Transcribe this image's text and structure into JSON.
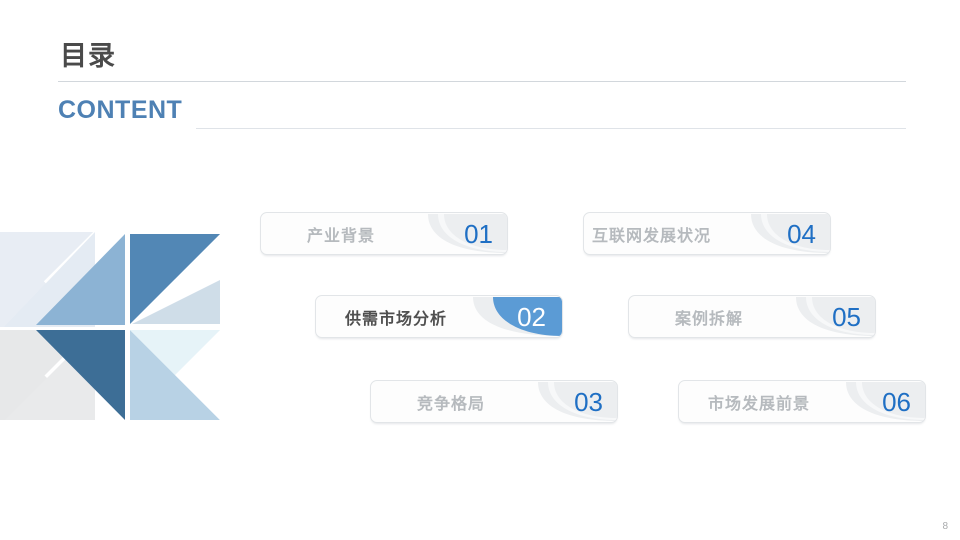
{
  "slide": {
    "page_number": "8",
    "accent_color": "#5b9bd5",
    "number_color": "#1f6fc4",
    "title_en_color": "#4e81b4"
  },
  "header": {
    "title_cn": "目录",
    "title_en": "CONTENT"
  },
  "toc": {
    "items": [
      {
        "label": "产业背景",
        "number": "01",
        "active": false,
        "position": 1
      },
      {
        "label": "供需市场分析",
        "number": "02",
        "active": true,
        "position": 2
      },
      {
        "label": "竞争格局",
        "number": "03",
        "active": false,
        "position": 3
      },
      {
        "label": "互联网发展状况",
        "number": "04",
        "active": false,
        "position": 4
      },
      {
        "label": "案例拆解",
        "number": "05",
        "active": false,
        "position": 5
      },
      {
        "label": "市场发展前景",
        "number": "06",
        "active": false,
        "position": 6
      }
    ]
  },
  "decoration": {
    "name": "triangle-mosaic",
    "colors": {
      "pale_blue": "#e8edf4",
      "pale_blue_2": "#e4ebf3",
      "neutral_gray": "#e7e8e9",
      "neutral_gray_2": "#e9eaeb",
      "medium_blue": "#8cb3d4",
      "steel_blue": "#5287b5",
      "deep_blue": "#3d6e96",
      "light_steel": "#cfdde8",
      "light_blue": "#b8d2e5",
      "ice_blue": "#e6f3f8"
    }
  }
}
